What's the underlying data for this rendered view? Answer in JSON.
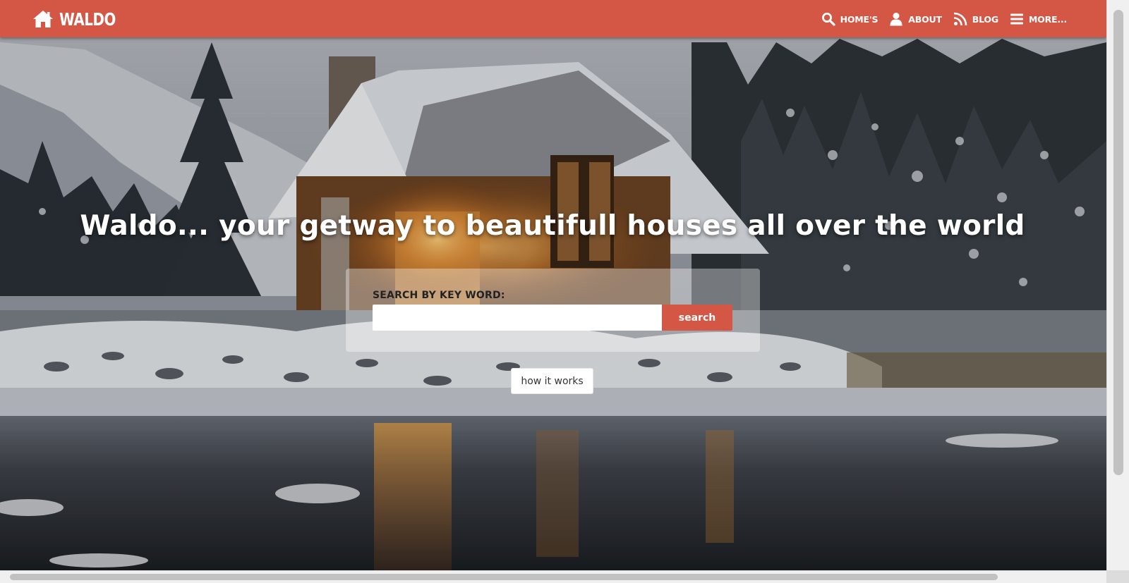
{
  "brand": {
    "name": "WALDO",
    "icon": "home-icon"
  },
  "nav": {
    "items": [
      {
        "label": "HOME'S",
        "icon": "search-icon"
      },
      {
        "label": "ABOUT",
        "icon": "user-icon"
      },
      {
        "label": "BLOG",
        "icon": "rss-icon"
      },
      {
        "label": "MORE...",
        "icon": "menu-icon"
      }
    ]
  },
  "hero": {
    "title": "Waldo... your getway to beautifull houses all over the world",
    "background": "snowy-cabin-lake-photo"
  },
  "search": {
    "label": "SEARCH BY KEY WORD:",
    "value": "",
    "placeholder": "",
    "button_label": "search"
  },
  "how_it_works": {
    "label": "how it works"
  },
  "colors": {
    "accent": "#d45746",
    "panel": "rgba(255,255,255,0.36)",
    "text_light": "#ffffff",
    "text_dark": "#222222"
  }
}
